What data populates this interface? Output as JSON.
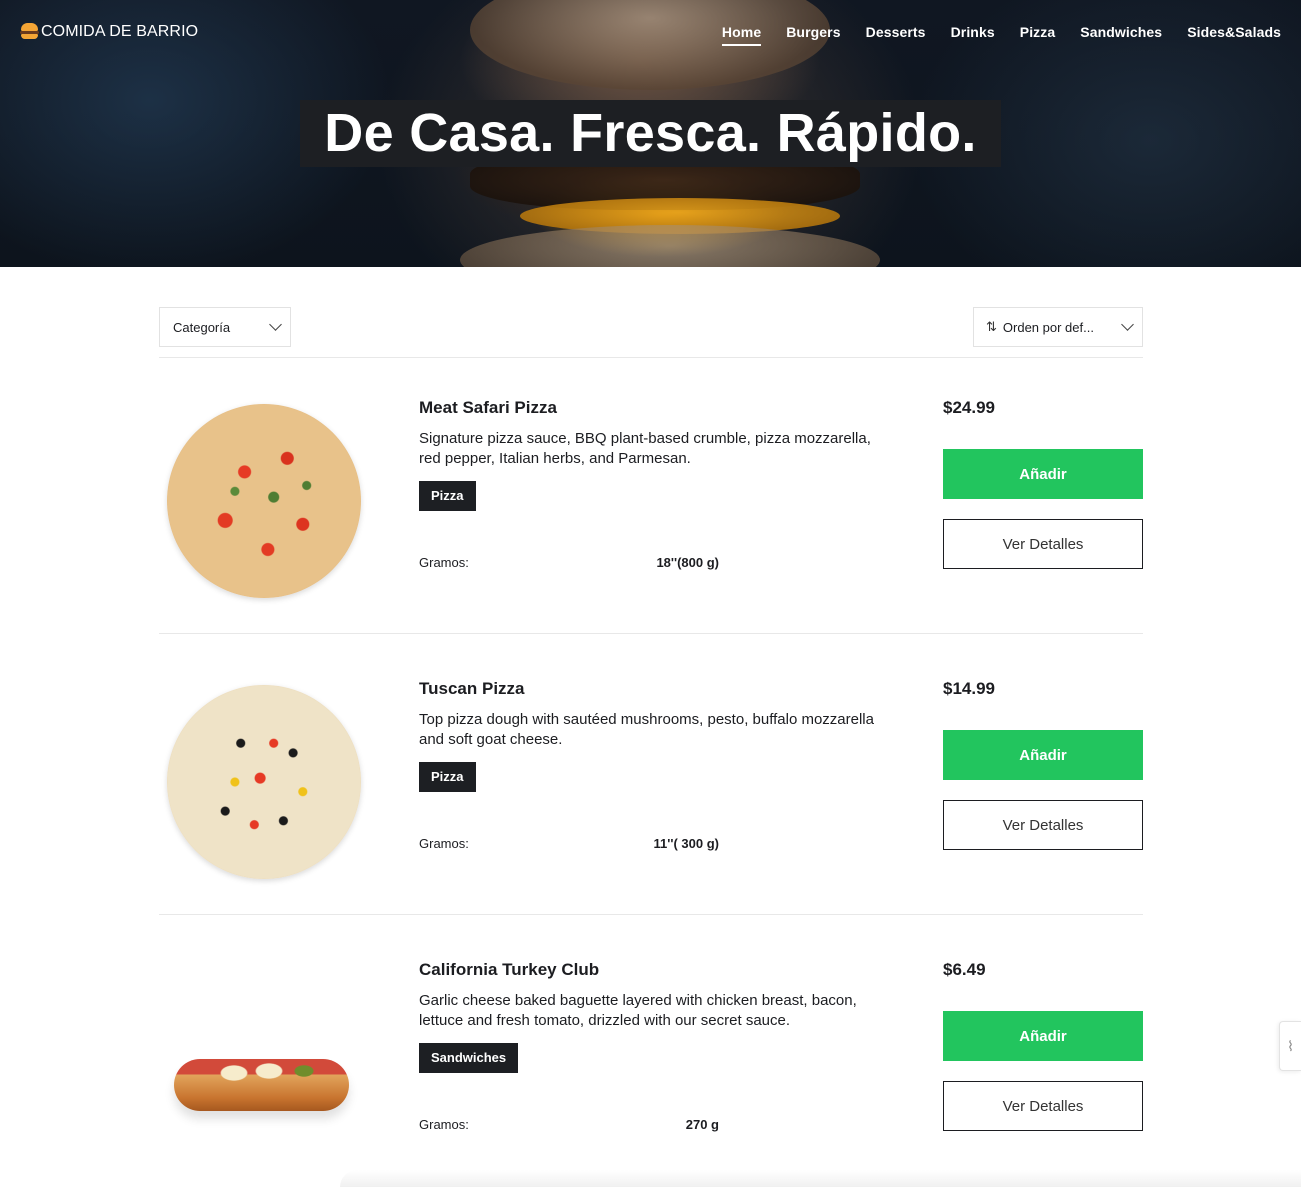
{
  "brand": {
    "name": "COMIDA DE BARRIO",
    "icon": "burger-icon"
  },
  "nav": {
    "items": [
      {
        "label": "Home",
        "active": true
      },
      {
        "label": "Burgers",
        "active": false
      },
      {
        "label": "Desserts",
        "active": false
      },
      {
        "label": "Drinks",
        "active": false
      },
      {
        "label": "Pizza",
        "active": false
      },
      {
        "label": "Sandwiches",
        "active": false
      },
      {
        "label": "Sides&Salads",
        "active": false
      }
    ]
  },
  "hero": {
    "headline": "De Casa. Fresca. Rápido."
  },
  "filters": {
    "category_label": "Categoría",
    "sort_label": "Orden por def...",
    "sort_icon": "sort-arrows-icon"
  },
  "products": [
    {
      "name": "Meat Safari Pizza",
      "description": "Signature pizza sauce, BBQ plant-based crumble, pizza mozzarella, red pepper, Italian herbs, and Parmesan.",
      "tag": "Pizza",
      "grams_label": "Gramos:",
      "grams_value": "18''(800 g)",
      "price": "$24.99",
      "add_label": "Añadir",
      "details_label": "Ver Detalles"
    },
    {
      "name": "Tuscan Pizza",
      "description": "Top pizza dough with sautéed mushrooms, pesto, buffalo mozzarella and soft goat cheese.",
      "tag": "Pizza",
      "grams_label": "Gramos:",
      "grams_value": "11''( 300 g)",
      "price": "$14.99",
      "add_label": "Añadir",
      "details_label": "Ver Detalles"
    },
    {
      "name": "California Turkey Club",
      "description": "Garlic cheese baked baguette layered with chicken breast, bacon, lettuce and fresh tomato, drizzled with our secret sauce.",
      "tag": "Sandwiches",
      "grams_label": "Gramos:",
      "grams_value": "270 g",
      "price": "$6.49",
      "add_label": "Añadir",
      "details_label": "Ver Detalles"
    }
  ],
  "colors": {
    "accent_green": "#22c55e",
    "dark": "#1d1f23"
  },
  "side_widget": {
    "icon": "chat-widget-icon"
  }
}
